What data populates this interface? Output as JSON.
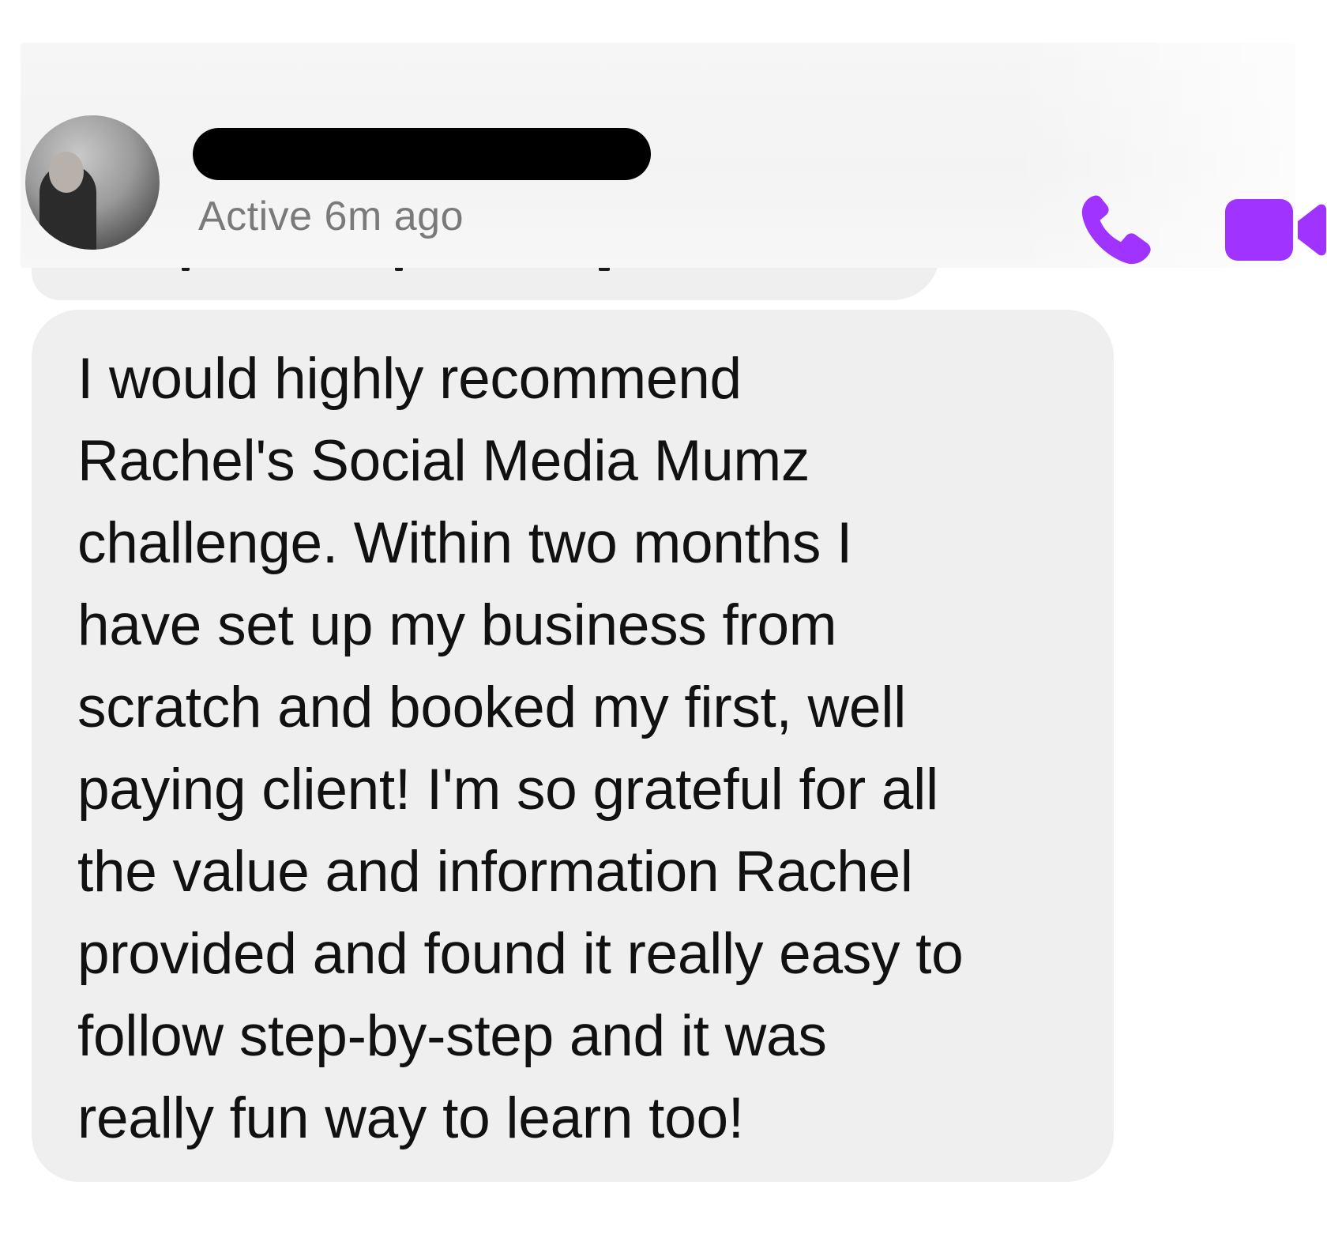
{
  "header": {
    "status": "Active 6m ago",
    "actions": [
      {
        "name": "phone-icon",
        "label": ""
      },
      {
        "name": "video-camera-icon",
        "label": ""
      }
    ]
  },
  "colors": {
    "accent": "#a033ff",
    "bubble_bg": "#efefef",
    "status_text": "#7a7a7a",
    "message_text": "#111111"
  },
  "message": {
    "text": "I would highly recommend\nRachel's Social Media Mumz\nchallenge. Within two months I\nhave set up my business from\nscratch and booked my first, well\npaying client! I'm so grateful for all\nthe value and information Rachel\nprovided and found it really easy to\nfollow step-by-step and it was\nreally fun way to learn too!"
  }
}
